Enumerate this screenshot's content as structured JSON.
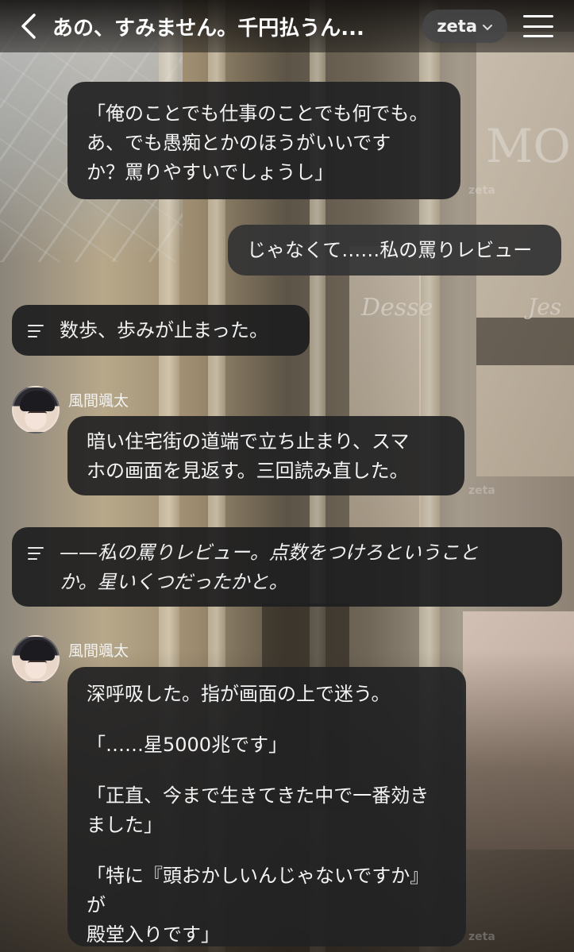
{
  "header": {
    "title": "あの、すみません。千円払うん...",
    "model_label": "zeta"
  },
  "messages": {
    "m1_lines": [
      "「俺のことでも仕事のことでも何でも。",
      "あ、でも愚痴とかのほうがいいです",
      "か？罵りやすいでしょうし」"
    ],
    "m2_text": "じゃなくて……私の罵りレビュー",
    "m3_text": "数歩、歩みが止まった。",
    "m4_sender": "風間颯太",
    "m4_lines": [
      "暗い住宅街の道端で立ち止まり、スマ",
      "ホの画面を見返す。三回読み直した。"
    ],
    "m5_lines": [
      "——私の罵りレビュー。点数をつけろということ",
      "か。星いくつだったかと。"
    ],
    "m6_sender": "風間颯太",
    "m6_p1": "深呼吸した。指が画面の上で迷う。",
    "m6_p2": "「……星5000兆です」",
    "m6_p3_lines": [
      "「正直、今まで生きてきた中で一番効き",
      "ました」"
    ],
    "m6_p4_lines": [
      "「特に『頭おかしいんじゃないですか』が",
      "殿堂入りです」"
    ]
  },
  "watermark": "zeta",
  "icons": {
    "back": "chevron-left-icon",
    "model_dropdown": "chevron-down-icon",
    "menu": "hamburger-menu-icon",
    "narration": "narration-lines-icon"
  },
  "colors": {
    "bubble": "#222223",
    "user_bubble": "#343435",
    "text": "#f4f4f4"
  }
}
